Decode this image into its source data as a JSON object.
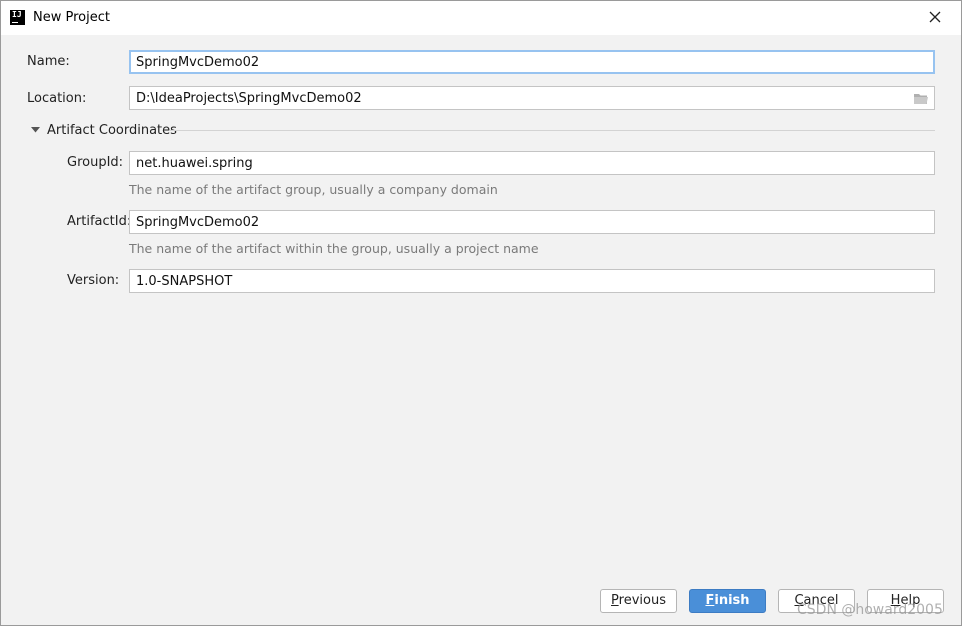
{
  "window": {
    "title": "New Project",
    "icon": "intellij-app-icon"
  },
  "form": {
    "name_label": "Name:",
    "name_value": "SpringMvcDemo02",
    "location_label": "Location:",
    "location_value": "D:\\IdeaProjects\\SpringMvcDemo02",
    "location_browse_icon": "folder-icon"
  },
  "artifact": {
    "section_title": "Artifact Coordinates",
    "group_label": "GroupId:",
    "group_value": "net.huawei.spring",
    "group_hint": "The name of the artifact group, usually a company domain",
    "artifact_label": "ArtifactId:",
    "artifact_value": "SpringMvcDemo02",
    "artifact_hint": "The name of the artifact within the group, usually a project name",
    "version_label": "Version:",
    "version_value": "1.0-SNAPSHOT"
  },
  "buttons": {
    "previous": {
      "mnemonic": "P",
      "rest": "revious"
    },
    "finish": {
      "mnemonic": "F",
      "rest": "inish"
    },
    "cancel": {
      "mnemonic": "C",
      "rest": "ancel"
    },
    "help": {
      "mnemonic": "H",
      "rest": "elp"
    }
  },
  "watermark": "CSDN @howard2005",
  "colors": {
    "primary_button": "#4a8fd8",
    "focus_ring": "#97c3f0",
    "hint_text": "#7a7a7a"
  }
}
